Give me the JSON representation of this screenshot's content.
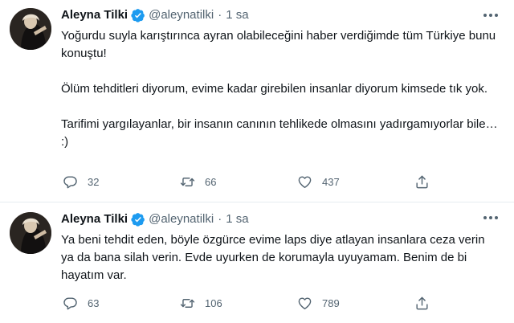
{
  "colors": {
    "verified": "#1d9bf0",
    "secondary_text": "#536471",
    "divider": "#e6ecf0"
  },
  "tweets": [
    {
      "author": {
        "name": "Aleyna Tilki",
        "handle": "@aleynatilki",
        "verified_icon": "verified-badge-icon"
      },
      "separator": "·",
      "time": "1 sa",
      "paragraphs": [
        "Yoğurdu suyla karıştırınca ayran olabileceğini haber verdiğimde tüm Türkiye bunu konuştu!",
        "Ölüm tehditleri diyorum, evime kadar girebilen insanlar diyorum kimsede tık yok.",
        "Tarifimi yargılayanlar, bir insanın canının tehlikede olmasını yadırgamıyorlar bile… :)"
      ],
      "stats": {
        "replies": "32",
        "retweets": "66",
        "likes": "437"
      }
    },
    {
      "author": {
        "name": "Aleyna Tilki",
        "handle": "@aleynatilki",
        "verified_icon": "verified-badge-icon"
      },
      "separator": "·",
      "time": "1 sa",
      "paragraphs": [
        "Ya beni tehdit eden, böyle özgürce evime laps diye atlayan insanlara ceza verin  ya da bana silah verin. Evde uyurken de korumayla uyuyamam. Benim de bi hayatım var."
      ],
      "stats": {
        "replies": "63",
        "retweets": "106",
        "likes": "789"
      }
    }
  ]
}
